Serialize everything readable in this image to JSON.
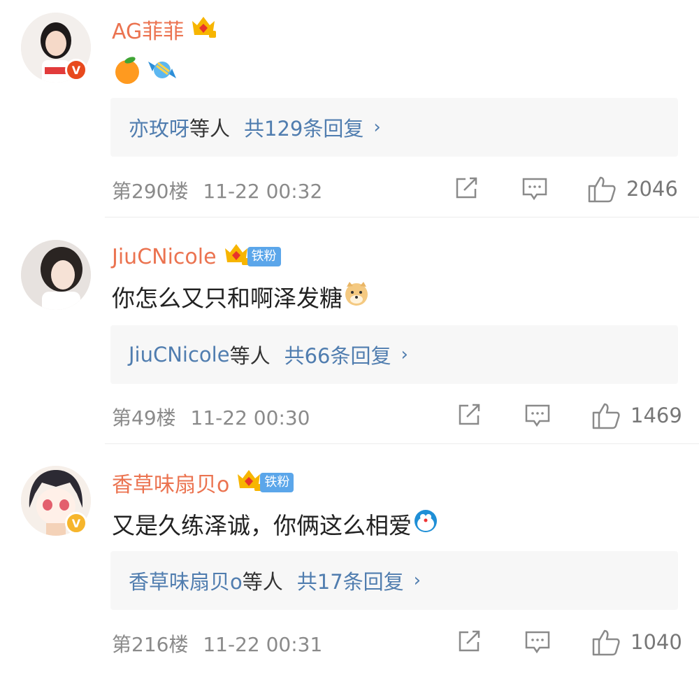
{
  "comments": [
    {
      "username": "AG菲菲",
      "fan_badge": "",
      "verified_color": "#e8491d",
      "content_text": "",
      "content_emojis": [
        "tangerine-emoji",
        "candy-emoji"
      ],
      "reply_users": "亦玫呀",
      "reply_suffix": "等人",
      "reply_total": "共129条回复",
      "floor": "第290楼",
      "time": "11-22 00:32",
      "likes": "2046"
    },
    {
      "username": "JiuCNicole",
      "fan_badge": "铁粉",
      "verified_color": "",
      "content_text": "你怎么又只和啊泽发糖",
      "content_emojis": [
        "doge-emoji"
      ],
      "reply_users": "JiuCNicole",
      "reply_suffix": "等人",
      "reply_total": "共66条回复",
      "floor": "第49楼",
      "time": "11-22 00:30",
      "likes": "1469"
    },
    {
      "username": "香草味扇贝o",
      "fan_badge": "铁粉",
      "verified_color": "#f6b52c",
      "content_text": "又是久练泽诚，你俩这么相爱",
      "content_emojis": [
        "doraemon-emoji"
      ],
      "reply_users": "香草味扇贝o",
      "reply_suffix": "等人",
      "reply_total": "共17条回复",
      "floor": "第216楼",
      "time": "11-22 00:31",
      "likes": "1040"
    }
  ],
  "icons": {
    "share": "share-icon",
    "comment": "comment-icon",
    "like": "like-icon",
    "chevron": "›"
  },
  "colors": {
    "username": "#eb7350",
    "reply_link": "#507daf",
    "meta": "#8a8a8a"
  }
}
